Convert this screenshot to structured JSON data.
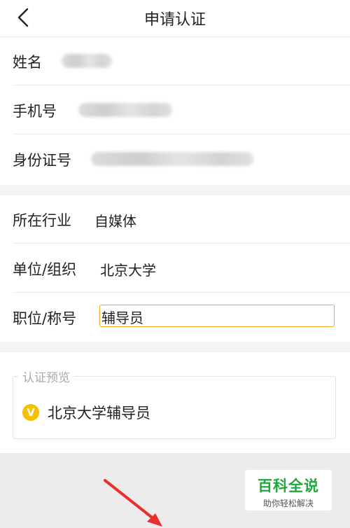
{
  "header": {
    "title": "申请认证",
    "back_icon": "chevron-left-icon"
  },
  "personal": {
    "name_label": "姓名",
    "phone_label": "手机号",
    "id_label": "身份证号"
  },
  "work": {
    "industry_label": "所在行业",
    "industry_value": "自媒体",
    "org_label": "单位/组织",
    "org_value": "北京大学",
    "position_label": "职位/称号",
    "position_value": "辅导员"
  },
  "preview": {
    "legend": "认证预览",
    "badge_letter": "V",
    "text": "北京大学辅导员"
  },
  "watermark": {
    "title": "百科全说",
    "subtitle": "助你轻松解决"
  },
  "colors": {
    "accent": "#f2a623",
    "badge": "#f5c000",
    "arrow": "#e8302c",
    "watermark_green": "#1fa83a"
  }
}
